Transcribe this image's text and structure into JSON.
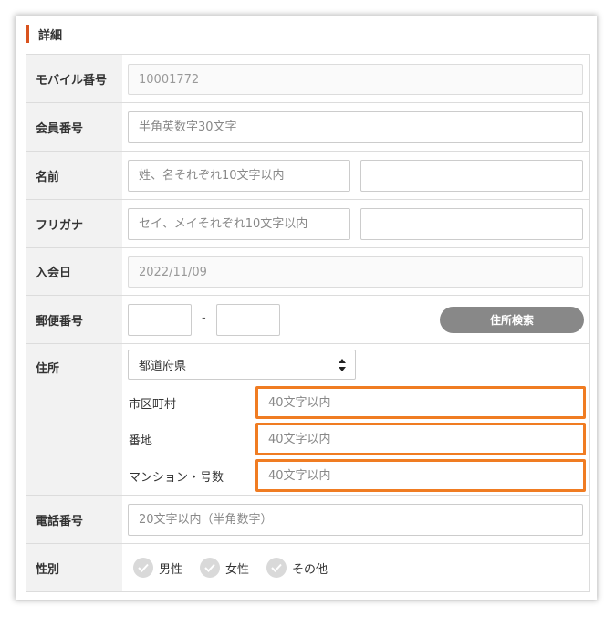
{
  "section": {
    "title": "詳細"
  },
  "fields": {
    "mobile_number": {
      "label": "モバイル番号",
      "value": "10001772"
    },
    "member_number": {
      "label": "会員番号",
      "placeholder": "半角英数字30文字"
    },
    "name": {
      "label": "名前",
      "placeholder": "姓、名それぞれ10文字以内",
      "placeholder2": ""
    },
    "furigana": {
      "label": "フリガナ",
      "placeholder": "セイ、メイそれぞれ10文字以内",
      "placeholder2": ""
    },
    "join_date": {
      "label": "入会日",
      "value": "2022/11/09"
    },
    "postal_code": {
      "label": "郵便番号",
      "separator": "-",
      "search_button": "住所検索"
    },
    "address": {
      "label": "住所",
      "prefecture_selected": "都道府県",
      "city_label": "市区町村",
      "city_placeholder": "40文字以内",
      "street_label": "番地",
      "street_placeholder": "40文字以内",
      "building_label": "マンション・号数",
      "building_placeholder": "40文字以内"
    },
    "phone": {
      "label": "電話番号",
      "placeholder": "20文字以内（半角数字）"
    },
    "gender": {
      "label": "性別",
      "options": [
        "男性",
        "女性",
        "その他"
      ]
    }
  },
  "colors": {
    "accent": "#d9531e",
    "highlight": "#f07c22",
    "button": "#888888"
  }
}
